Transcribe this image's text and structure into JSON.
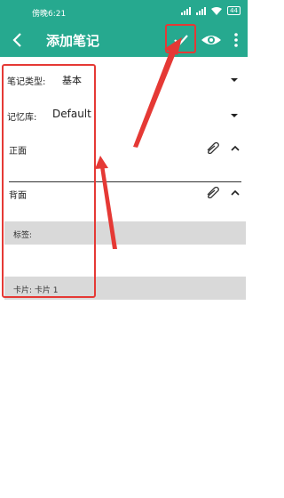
{
  "status_bar": {
    "time": "傍晚6:21",
    "battery": "44"
  },
  "toolbar": {
    "title": "添加笔记",
    "icons": [
      "back-arrow-icon",
      "check-icon",
      "eye-icon",
      "more-vert-icon"
    ]
  },
  "form": {
    "note_type_label": "笔记类型:",
    "note_type_value": "基本",
    "deck_label": "记忆库:",
    "deck_value": "Default",
    "front_label": "正面",
    "back_label": "背面",
    "tags_label": "标签:",
    "cards_label": "卡片: 卡片 1"
  },
  "colors": {
    "toolbar": "#26a98f",
    "annotation": "#e53935",
    "gray_bar": "#d9d9d9"
  }
}
